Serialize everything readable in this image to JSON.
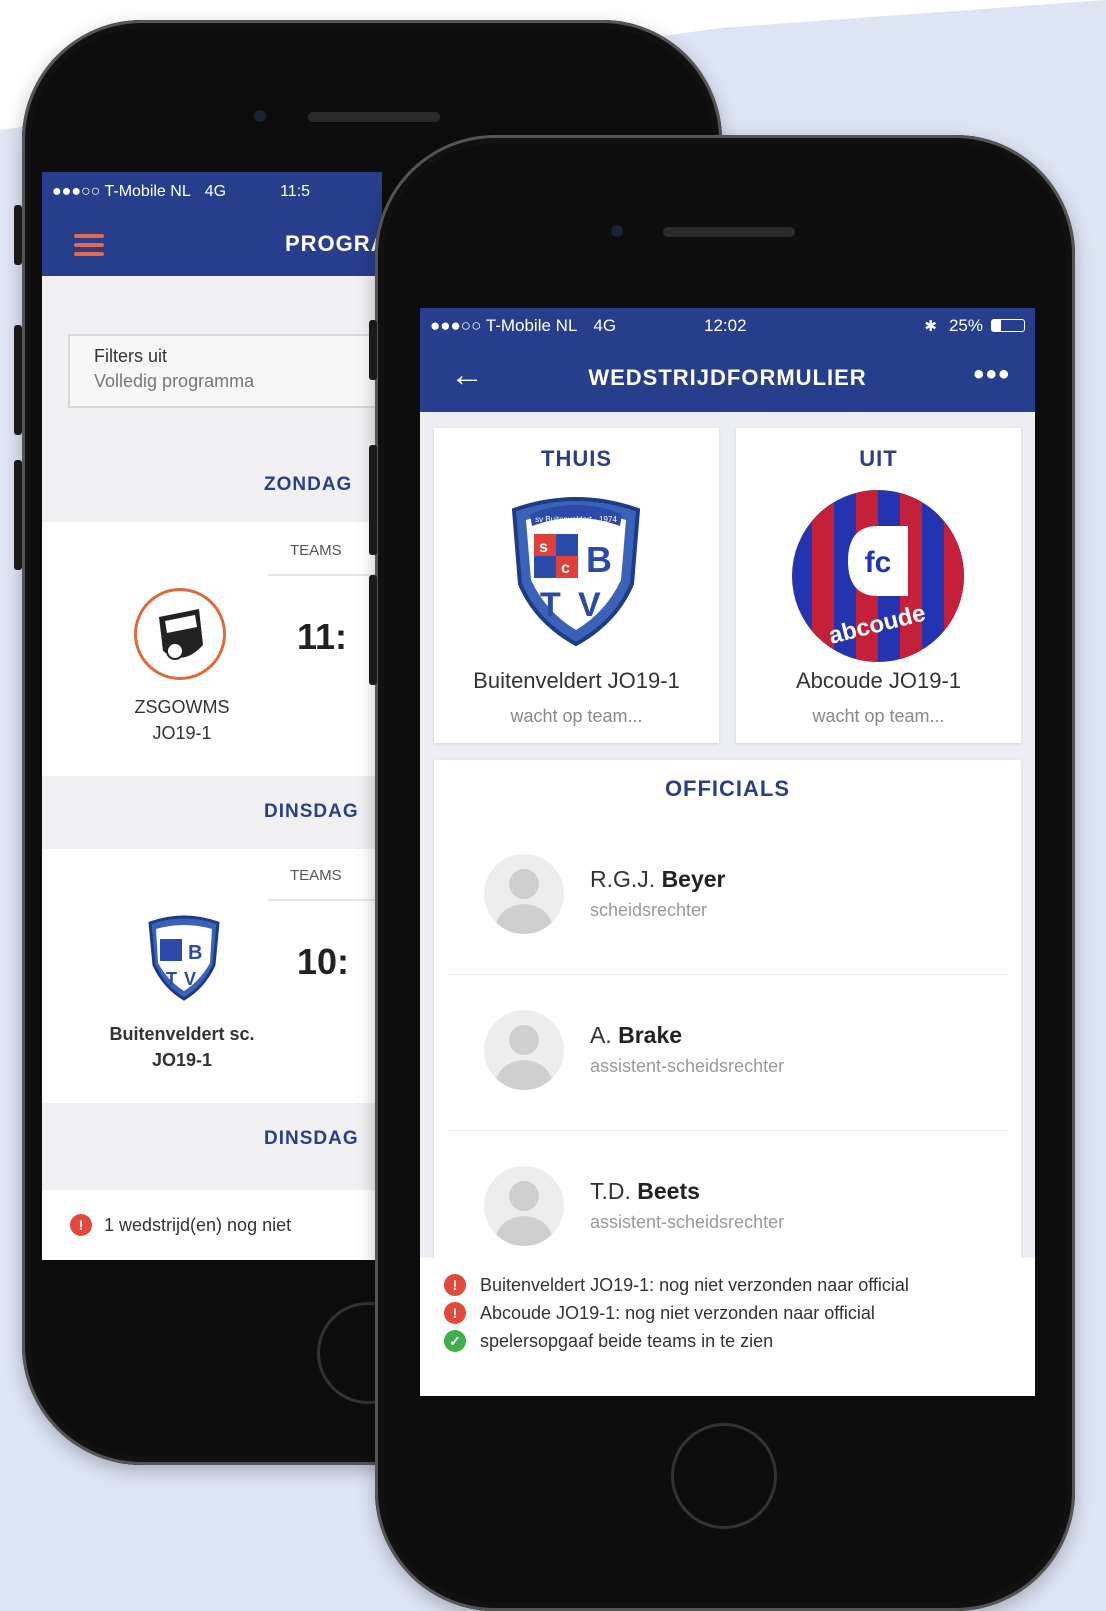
{
  "back_phone": {
    "status": {
      "carrier": "●●●○○ T-Mobile NL",
      "network": "4G",
      "time": "11:5"
    },
    "title": "PROGRA",
    "filters": {
      "line1": "Filters uit",
      "line2": "Volledig programma"
    },
    "days": [
      {
        "label": "ZONDAG"
      },
      {
        "label": "DINSDAG"
      },
      {
        "label": "DINSDAG"
      }
    ],
    "matches": [
      {
        "club": "ZSGOWMS",
        "team": "JO19-1",
        "teams_label": "TEAMS",
        "time": "11:"
      },
      {
        "club": "Buitenveldert sc.",
        "team": "JO19-1",
        "teams_label": "TEAMS",
        "time": "10:"
      }
    ],
    "alert": "1 wedstrijd(en) nog niet"
  },
  "front_phone": {
    "status": {
      "carrier": "●●●○○ T-Mobile NL",
      "network": "4G",
      "time": "12:02",
      "battery": "25%"
    },
    "title": "WEDSTRIJDFORMULIER",
    "home": {
      "side": "THUIS",
      "name": "Buitenveldert JO19-1",
      "status": "wacht op team..."
    },
    "away": {
      "side": "UIT",
      "name": "Abcoude JO19-1",
      "status": "wacht op team..."
    },
    "officials_title": "OFFICIALS",
    "officials": [
      {
        "initials": "R.G.J.",
        "surname": "Beyer",
        "role": "scheidsrechter"
      },
      {
        "initials": "A.",
        "surname": "Brake",
        "role": "assistent-scheidsrechter"
      },
      {
        "initials": "T.D.",
        "surname": "Beets",
        "role": "assistent-scheidsrechter"
      }
    ],
    "alerts": [
      {
        "text": "Buitenveldert JO19-1: nog niet verzonden naar official",
        "status": "error"
      },
      {
        "text": "Abcoude JO19-1: nog niet verzonden naar official",
        "status": "error"
      },
      {
        "text": "spelersopgaaf beide teams in te zien",
        "status": "ok"
      }
    ],
    "logos": {
      "bvd_text": "sv Buitenveldert · 1974",
      "fc_text": "fc",
      "abcoude_text": "abcoude"
    }
  },
  "colors": {
    "nav": "#273e8c",
    "accent": "#2c3f86",
    "error": "#e2493b",
    "ok": "#3fae4e",
    "menu": "#e8684a"
  }
}
